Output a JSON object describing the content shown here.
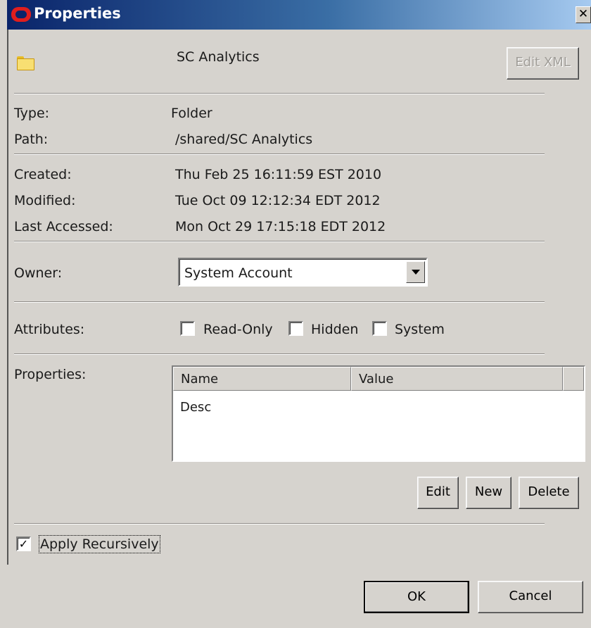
{
  "window": {
    "title": "Properties",
    "close_glyph": "✕"
  },
  "header": {
    "folder_name": "SC Analytics",
    "edit_xml_label": "Edit XML"
  },
  "info": {
    "type_label": "Type:",
    "type_value": "Folder",
    "path_label": "Path:",
    "path_value": "/shared/SC Analytics",
    "created_label": "Created:",
    "created_value": "Thu Feb 25 16:11:59 EST 2010",
    "modified_label": "Modified:",
    "modified_value": "Tue Oct 09 12:12:34 EDT 2012",
    "accessed_label": "Last Accessed:",
    "accessed_value": "Mon Oct 29 17:15:18 EDT 2012"
  },
  "owner": {
    "label": "Owner:",
    "selected": "System Account"
  },
  "attributes": {
    "label": "Attributes:",
    "read_only": {
      "label": "Read-Only",
      "checked": false
    },
    "hidden": {
      "label": "Hidden",
      "checked": false
    },
    "system": {
      "label": "System",
      "checked": false
    }
  },
  "properties": {
    "label": "Properties:",
    "columns": [
      "Name",
      "Value"
    ],
    "rows": [
      {
        "name": "Desc",
        "value": ""
      }
    ],
    "edit_label": "Edit",
    "new_label": "New",
    "delete_label": "Delete"
  },
  "apply_recursively": {
    "label": "Apply Recursively",
    "checked": true,
    "check_glyph": "✓"
  },
  "footer": {
    "ok_label": "OK",
    "cancel_label": "Cancel"
  },
  "icons": [
    "oracle-logo-icon",
    "close-icon",
    "folder-icon",
    "dropdown-arrow-icon",
    "checkbox-check-icon"
  ]
}
